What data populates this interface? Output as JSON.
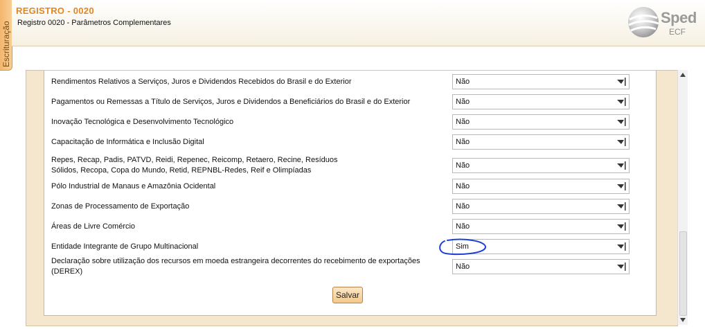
{
  "side_tab": {
    "label": "Escrituração"
  },
  "header": {
    "title": "REGISTRO - 0020",
    "subtitle": "Registro 0020 - Parâmetros Complementares",
    "logo_text": "Sped",
    "logo_sub": "ECF"
  },
  "form": {
    "rows": [
      {
        "label": "Rendimentos Relativos a Serviços, Juros e Dividendos Recebidos do Brasil e do Exterior",
        "value": "Não"
      },
      {
        "label": "Pagamentos ou Remessas a Título de Serviços, Juros e Dividendos a Beneficiários do Brasil e do Exterior",
        "value": "Não"
      },
      {
        "label": "Inovação Tecnológica e Desenvolvimento Tecnológico",
        "value": "Não"
      },
      {
        "label": "Capacitação de Informática e Inclusão Digital",
        "value": "Não"
      },
      {
        "label": "Repes, Recap, Padis, PATVD, Reidi, Repenec, Reicomp, Retaero, Recine, Resíduos Sólidos, Recopa, Copa do Mundo, Retid, REPNBL-Redes, Reif e Olimpíadas",
        "value": "Não"
      },
      {
        "label": "Pólo Industrial de Manaus e Amazônia Ocidental",
        "value": "Não"
      },
      {
        "label": "Zonas de Processamento de Exportação",
        "value": "Não"
      },
      {
        "label": "Áreas de Livre Comércio",
        "value": "Não"
      },
      {
        "label": "Entidade Integrante de Grupo Multinacional",
        "value": "Sim"
      },
      {
        "label": "Declaração sobre utilização dos recursos em moeda estrangeira decorrentes do recebimento de exportações (DEREX)",
        "value": "Não"
      }
    ],
    "save_label": "Salvar"
  },
  "colors": {
    "title_orange": "#e4861d",
    "panel_bg": "#f5e7cd",
    "annotation_circle": "#1e3fd6"
  }
}
